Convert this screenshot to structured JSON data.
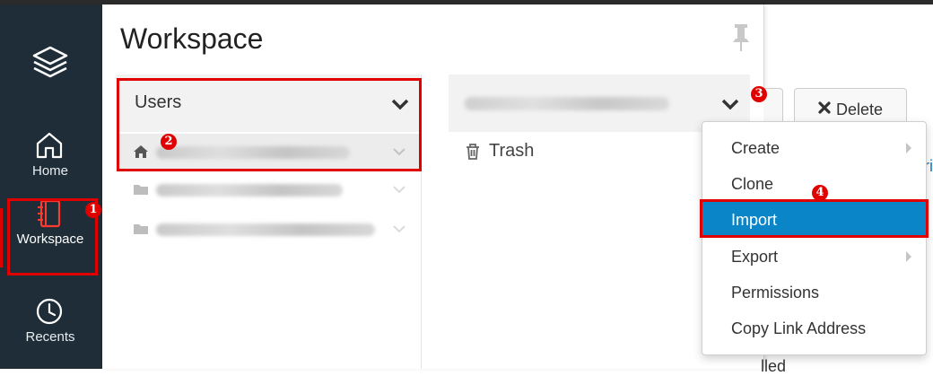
{
  "nav": {
    "items": [
      {
        "label": "Home",
        "icon": "home-icon"
      },
      {
        "label": "Workspace",
        "icon": "notebook-icon"
      },
      {
        "label": "Recents",
        "icon": "clock-icon"
      }
    ],
    "logo_icon": "layers-logo-icon"
  },
  "workspace": {
    "title": "Workspace",
    "users_header": "Users",
    "user_rows": [
      {
        "icon": "home-icon"
      },
      {
        "icon": "folder-icon"
      },
      {
        "icon": "folder-icon"
      }
    ],
    "trash_label": "Trash"
  },
  "toolbar": {
    "delete_label": "Delete"
  },
  "context_menu": {
    "items": [
      {
        "label": "Create",
        "has_submenu": true
      },
      {
        "label": "Clone",
        "has_submenu": false
      },
      {
        "label": "Import",
        "has_submenu": false,
        "selected": true
      },
      {
        "label": "Export",
        "has_submenu": true
      },
      {
        "label": "Permissions",
        "has_submenu": false
      },
      {
        "label": "Copy Link Address",
        "has_submenu": false
      }
    ]
  },
  "annotations": {
    "steps": [
      "1",
      "2",
      "3",
      "4"
    ],
    "color": "#e00000"
  },
  "partial_text": {
    "right_edge": "ri",
    "bottom": "lled"
  },
  "colors": {
    "nav_bg": "#1e2d37",
    "accent": "#0a85c7",
    "highlight": "#e00000"
  }
}
